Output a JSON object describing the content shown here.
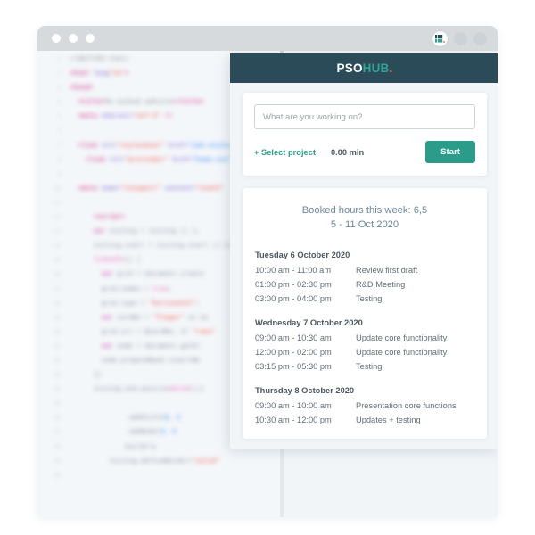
{
  "window": {
    "traffic_lights": [
      "close",
      "minimize",
      "maximize"
    ],
    "extension_icon": "psohub-extension-icon",
    "toolbar_icons": [
      "toolbar-circle-1",
      "toolbar-circle-2"
    ]
  },
  "panel": {
    "logo": {
      "part1": "PSO",
      "part2": "HUB",
      "part3": "."
    },
    "colors": {
      "header_bg": "#2c4b59",
      "accent_teal": "#2b9c8a",
      "logo_teal": "#31a395",
      "logo_dot": "#f0625d",
      "panel_bg": "#f1f5f8",
      "title_blue": "#6d87a0"
    }
  },
  "tracker": {
    "input_placeholder": "What are you working on?",
    "input_value": "",
    "select_project_label": "+ Select project",
    "timer_value": "0.00 min",
    "start_label": "Start"
  },
  "agenda": {
    "title_line1": "Booked hours this week: 6,5",
    "title_line2": "5 - 11 Oct 2020",
    "days": [
      {
        "heading": "Tuesday 6 October 2020",
        "entries": [
          {
            "time": "10:00 am - 11:00 am",
            "desc": "Review first draft"
          },
          {
            "time": "01:00 pm - 02:30 pm",
            "desc": "R&D Meeting"
          },
          {
            "time": "03:00 pm - 04:00 pm",
            "desc": "Testing"
          }
        ]
      },
      {
        "heading": "Wednesday 7 October 2020",
        "entries": [
          {
            "time": "09:00 am - 10:30 am",
            "desc": "Update core functionality"
          },
          {
            "time": "12:00 pm - 02:00 pm",
            "desc": "Update core functionality"
          },
          {
            "time": "03:15 pm - 05:30 pm",
            "desc": "Testing"
          }
        ]
      },
      {
        "heading": "Thursday 8 October 2020",
        "entries": [
          {
            "time": "09:00 am - 10:00 am",
            "desc": "Presentation core functions"
          },
          {
            "time": "10:30 am - 12:00 pm",
            "desc": "Updates +  testing"
          }
        ]
      }
    ]
  },
  "editor": {
    "lines": [
      {
        "n": "1",
        "tokens": [
          {
            "t": "pln",
            "s": "<!DOCTYPE html>"
          }
        ]
      },
      {
        "n": "2",
        "tokens": [
          {
            "t": "tag",
            "s": "<html "
          },
          {
            "t": "attr",
            "s": "lang"
          },
          {
            "t": "str",
            "s": "\"en\""
          },
          {
            "t": "tag",
            "s": ">"
          }
        ]
      },
      {
        "n": "3",
        "tokens": [
          {
            "t": "tag",
            "s": "<head>"
          }
        ]
      },
      {
        "n": "4",
        "tokens": [
          {
            "t": "pln",
            "s": "  "
          },
          {
            "t": "tag",
            "s": "<title>"
          },
          {
            "t": "pln",
            "s": "My psohub website"
          },
          {
            "t": "tag",
            "s": "</title>"
          }
        ]
      },
      {
        "n": "5",
        "tokens": [
          {
            "t": "pln",
            "s": "  "
          },
          {
            "t": "tag",
            "s": "<meta "
          },
          {
            "t": "attr",
            "s": "charset="
          },
          {
            "t": "str",
            "s": "\"utf-8\""
          },
          {
            "t": "tag",
            "s": " />"
          }
        ]
      },
      {
        "n": "6",
        "tokens": []
      },
      {
        "n": "7",
        "tokens": [
          {
            "t": "pln",
            "s": "  "
          },
          {
            "t": "tag",
            "s": "<link "
          },
          {
            "t": "attr",
            "s": "rel="
          },
          {
            "t": "str",
            "s": "\"stylesheet\""
          },
          {
            "t": "attr",
            "s": " href="
          },
          {
            "t": "val",
            "s": "\"job-styles.css\""
          }
        ]
      },
      {
        "n": "8",
        "tokens": [
          {
            "t": "pln",
            "s": "    "
          },
          {
            "t": "tag",
            "s": "<link "
          },
          {
            "t": "attr",
            "s": "rel="
          },
          {
            "t": "str",
            "s": "\"prerender\""
          },
          {
            "t": "attr",
            "s": " href="
          },
          {
            "t": "val",
            "s": "\"home.css\""
          }
        ]
      },
      {
        "n": "9",
        "tokens": []
      },
      {
        "n": "10",
        "tokens": [
          {
            "t": "pln",
            "s": "  "
          },
          {
            "t": "tag",
            "s": "<meta "
          },
          {
            "t": "attr",
            "s": "name="
          },
          {
            "t": "str",
            "s": "\"viewport\""
          },
          {
            "t": "attr",
            "s": " content="
          },
          {
            "t": "str",
            "s": "\"width\""
          }
        ]
      },
      {
        "n": "11",
        "tokens": []
      },
      {
        "n": "12",
        "tokens": [
          {
            "t": "pln",
            "s": "      "
          },
          {
            "t": "tag",
            "s": "<script>"
          }
        ]
      },
      {
        "n": "13",
        "tokens": [
          {
            "t": "pln",
            "s": "      "
          },
          {
            "t": "kw",
            "s": "var"
          },
          {
            "t": "pln",
            "s": " styling = styling () {;"
          }
        ]
      },
      {
        "n": "14",
        "tokens": [
          {
            "t": "pln",
            "s": "      styling.start = styling.start () {};"
          }
        ]
      },
      {
        "n": "15",
        "tokens": [
          {
            "t": "pln",
            "s": "      "
          },
          {
            "t": "fn",
            "s": "linkedTo"
          },
          {
            "t": "pln",
            "s": "() {"
          }
        ]
      },
      {
        "n": "16",
        "tokens": [
          {
            "t": "pln",
            "s": "        "
          },
          {
            "t": "kw",
            "s": "var"
          },
          {
            "t": "pln",
            "s": " grid = document.create"
          }
        ]
      },
      {
        "n": "17",
        "tokens": [
          {
            "t": "pln",
            "s": "        grid.nodes = "
          },
          {
            "t": "pink",
            "s": "true"
          },
          {
            "t": "pln",
            "s": ";"
          }
        ]
      },
      {
        "n": "18",
        "tokens": [
          {
            "t": "pln",
            "s": "        grid.type = "
          },
          {
            "t": "str",
            "s": "\"horizontal\""
          },
          {
            "t": "pln",
            "s": ";"
          }
        ]
      },
      {
        "n": "19",
        "tokens": [
          {
            "t": "pln",
            "s": "        "
          },
          {
            "t": "kw",
            "s": "var"
          },
          {
            "t": "pln",
            "s": " cardNo = "
          },
          {
            "t": "str",
            "s": "\"finger\""
          },
          {
            "t": "pln",
            "s": " as ba"
          }
        ]
      },
      {
        "n": "20",
        "tokens": [
          {
            "t": "pln",
            "s": "        grid.url = @cardNo; if "
          },
          {
            "t": "str",
            "s": "\"rows\""
          }
        ]
      },
      {
        "n": "21",
        "tokens": [
          {
            "t": "pln",
            "s": "        "
          },
          {
            "t": "kw",
            "s": "var"
          },
          {
            "t": "pln",
            "s": " node = document.getEl"
          }
        ]
      },
      {
        "n": "22",
        "tokens": [
          {
            "t": "pln",
            "s": "        node.prependNode.insertBe"
          }
        ]
      },
      {
        "n": "23",
        "tokens": [
          {
            "t": "pln",
            "s": "      }}"
          }
        ]
      },
      {
        "n": "24",
        "tokens": [
          {
            "t": "pln",
            "s": "      styling.end.positio"
          },
          {
            "t": "pink",
            "s": "nGrid"
          },
          {
            "t": "pln",
            "s": "();}"
          }
        ]
      },
      {
        "n": "25",
        "tokens": []
      },
      {
        "n": "26",
        "tokens": [
          {
            "t": "pln",
            "s": "               addStyle("
          },
          {
            "t": "val",
            "s": "8, 2"
          }
        ]
      },
      {
        "n": "27",
        "tokens": [
          {
            "t": "pln",
            "s": "               addNode("
          },
          {
            "t": "val",
            "s": "3, 0"
          }
        ]
      },
      {
        "n": "28",
        "tokens": [
          {
            "t": "pln",
            "s": "              buildrly"
          }
        ]
      },
      {
        "n": "29",
        "tokens": [
          {
            "t": "pln",
            "s": "          styling.defineBorder("
          },
          {
            "t": "str",
            "s": "\"solid\""
          }
        ]
      },
      {
        "n": "30",
        "tokens": []
      }
    ]
  }
}
